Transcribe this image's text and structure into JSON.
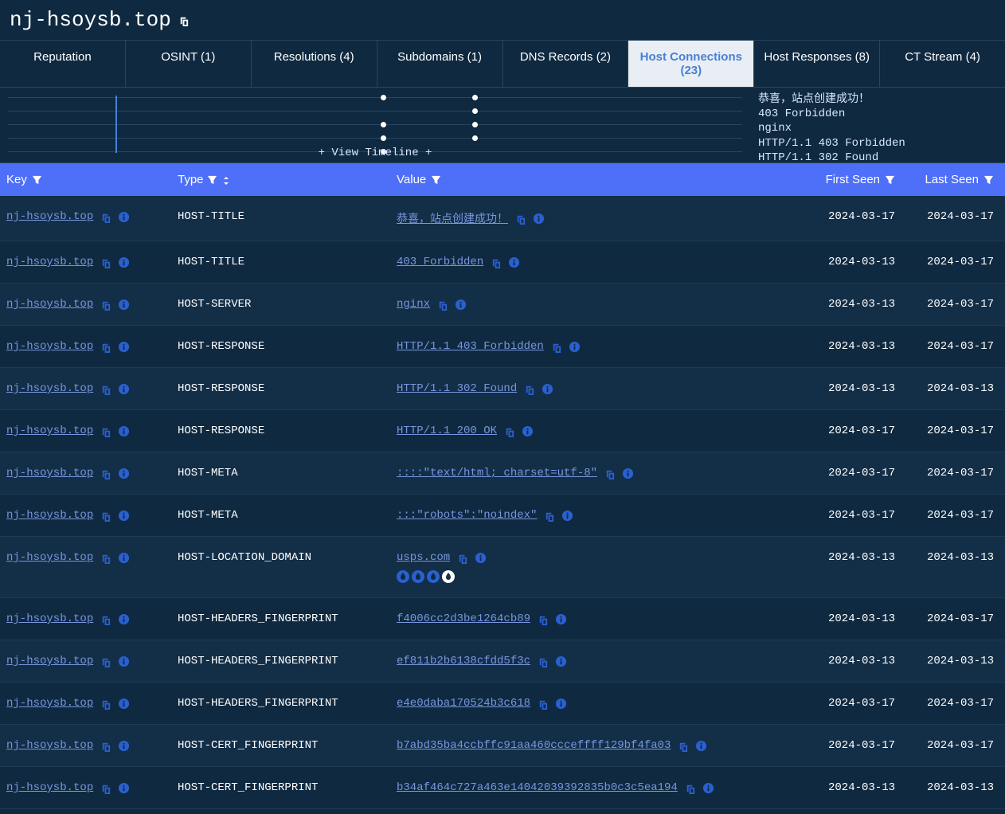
{
  "title": "nj-hsoysb.top",
  "tabs": [
    {
      "label": "Reputation",
      "active": false
    },
    {
      "label": "OSINT (1)",
      "active": false
    },
    {
      "label": "Resolutions (4)",
      "active": false
    },
    {
      "label": "Subdomains (1)",
      "active": false
    },
    {
      "label": "DNS Records (2)",
      "active": false
    },
    {
      "label": "Host Connections (23)",
      "active": true
    },
    {
      "label": "Host Responses (8)",
      "active": false
    },
    {
      "label": "CT Stream (4)",
      "active": false
    }
  ],
  "timeline_side": [
    "恭喜，站点创建成功！",
    "403 Forbidden",
    "nginx",
    "HTTP/1.1 403 Forbidden",
    "HTTP/1.1 302 Found"
  ],
  "timeline_button": "+ View Timeline +",
  "columns": {
    "key": "Key",
    "type": "Type",
    "value": "Value",
    "first": "First Seen",
    "last": "Last Seen"
  },
  "rows": [
    {
      "key": "nj-hsoysb.top",
      "type": "HOST-TITLE",
      "value": "恭喜，站点创建成功！",
      "first": "2024-03-17",
      "last": "2024-03-17"
    },
    {
      "key": "nj-hsoysb.top",
      "type": "HOST-TITLE",
      "value": "403 Forbidden",
      "first": "2024-03-13",
      "last": "2024-03-17"
    },
    {
      "key": "nj-hsoysb.top",
      "type": "HOST-SERVER",
      "value": "nginx",
      "first": "2024-03-13",
      "last": "2024-03-17"
    },
    {
      "key": "nj-hsoysb.top",
      "type": "HOST-RESPONSE",
      "value": "HTTP/1.1 403 Forbidden",
      "first": "2024-03-13",
      "last": "2024-03-17"
    },
    {
      "key": "nj-hsoysb.top",
      "type": "HOST-RESPONSE",
      "value": "HTTP/1.1 302 Found",
      "first": "2024-03-13",
      "last": "2024-03-13"
    },
    {
      "key": "nj-hsoysb.top",
      "type": "HOST-RESPONSE",
      "value": "HTTP/1.1 200 OK",
      "first": "2024-03-17",
      "last": "2024-03-17"
    },
    {
      "key": "nj-hsoysb.top",
      "type": "HOST-META",
      "value": "::::\"text/html; charset=utf-8\"",
      "first": "2024-03-17",
      "last": "2024-03-17"
    },
    {
      "key": "nj-hsoysb.top",
      "type": "HOST-META",
      "value": ":::\"robots\":\"noindex\"",
      "first": "2024-03-17",
      "last": "2024-03-17"
    },
    {
      "key": "nj-hsoysb.top",
      "type": "HOST-LOCATION_DOMAIN",
      "value": "usps.com",
      "first": "2024-03-13",
      "last": "2024-03-13",
      "flames": true
    },
    {
      "key": "nj-hsoysb.top",
      "type": "HOST-HEADERS_FINGERPRINT",
      "value": "f4006cc2d3be1264cb89",
      "first": "2024-03-13",
      "last": "2024-03-17"
    },
    {
      "key": "nj-hsoysb.top",
      "type": "HOST-HEADERS_FINGERPRINT",
      "value": "ef811b2b6138cfdd5f3c",
      "first": "2024-03-13",
      "last": "2024-03-13"
    },
    {
      "key": "nj-hsoysb.top",
      "type": "HOST-HEADERS_FINGERPRINT",
      "value": "e4e0daba170524b3c618",
      "first": "2024-03-17",
      "last": "2024-03-17"
    },
    {
      "key": "nj-hsoysb.top",
      "type": "HOST-CERT_FINGERPRINT",
      "value": "b7abd35ba4ccbffc91aa460ccceffff129bf4fa03",
      "first": "2024-03-17",
      "last": "2024-03-17"
    },
    {
      "key": "nj-hsoysb.top",
      "type": "HOST-CERT_FINGERPRINT",
      "value": "b34af464c727a463e14042039392835b0c3c5ea194",
      "first": "2024-03-13",
      "last": "2024-03-13"
    }
  ]
}
